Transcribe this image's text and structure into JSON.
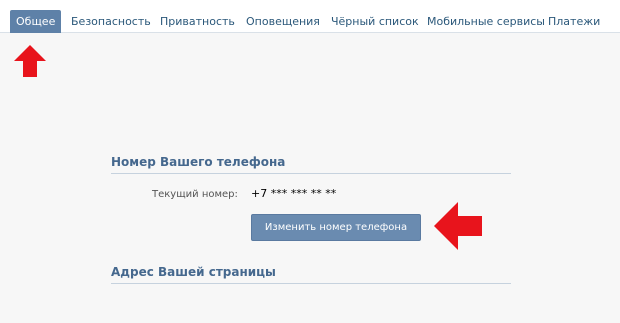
{
  "tabs": [
    {
      "label": "Общее",
      "active": true
    },
    {
      "label": "Безопасность",
      "active": false
    },
    {
      "label": "Приватность",
      "active": false
    },
    {
      "label": "Оповещения",
      "active": false
    },
    {
      "label": "Чёрный список",
      "active": false
    },
    {
      "label": "Мобильные сервисы",
      "active": false
    },
    {
      "label": "Платежи",
      "active": false
    }
  ],
  "phone_section": {
    "title": "Номер Вашего телефона",
    "current_label": "Текущий номер:",
    "current_value": "+7 *** *** ** **",
    "change_button": "Изменить номер телефона"
  },
  "address_section": {
    "title": "Адрес Вашей страницы"
  },
  "colors": {
    "accent": "#5e81a8",
    "link": "#2b587a",
    "section_title": "#45688e",
    "annotation_arrow": "#e8141c"
  },
  "annotations": [
    "arrow-up-icon",
    "arrow-left-icon"
  ]
}
